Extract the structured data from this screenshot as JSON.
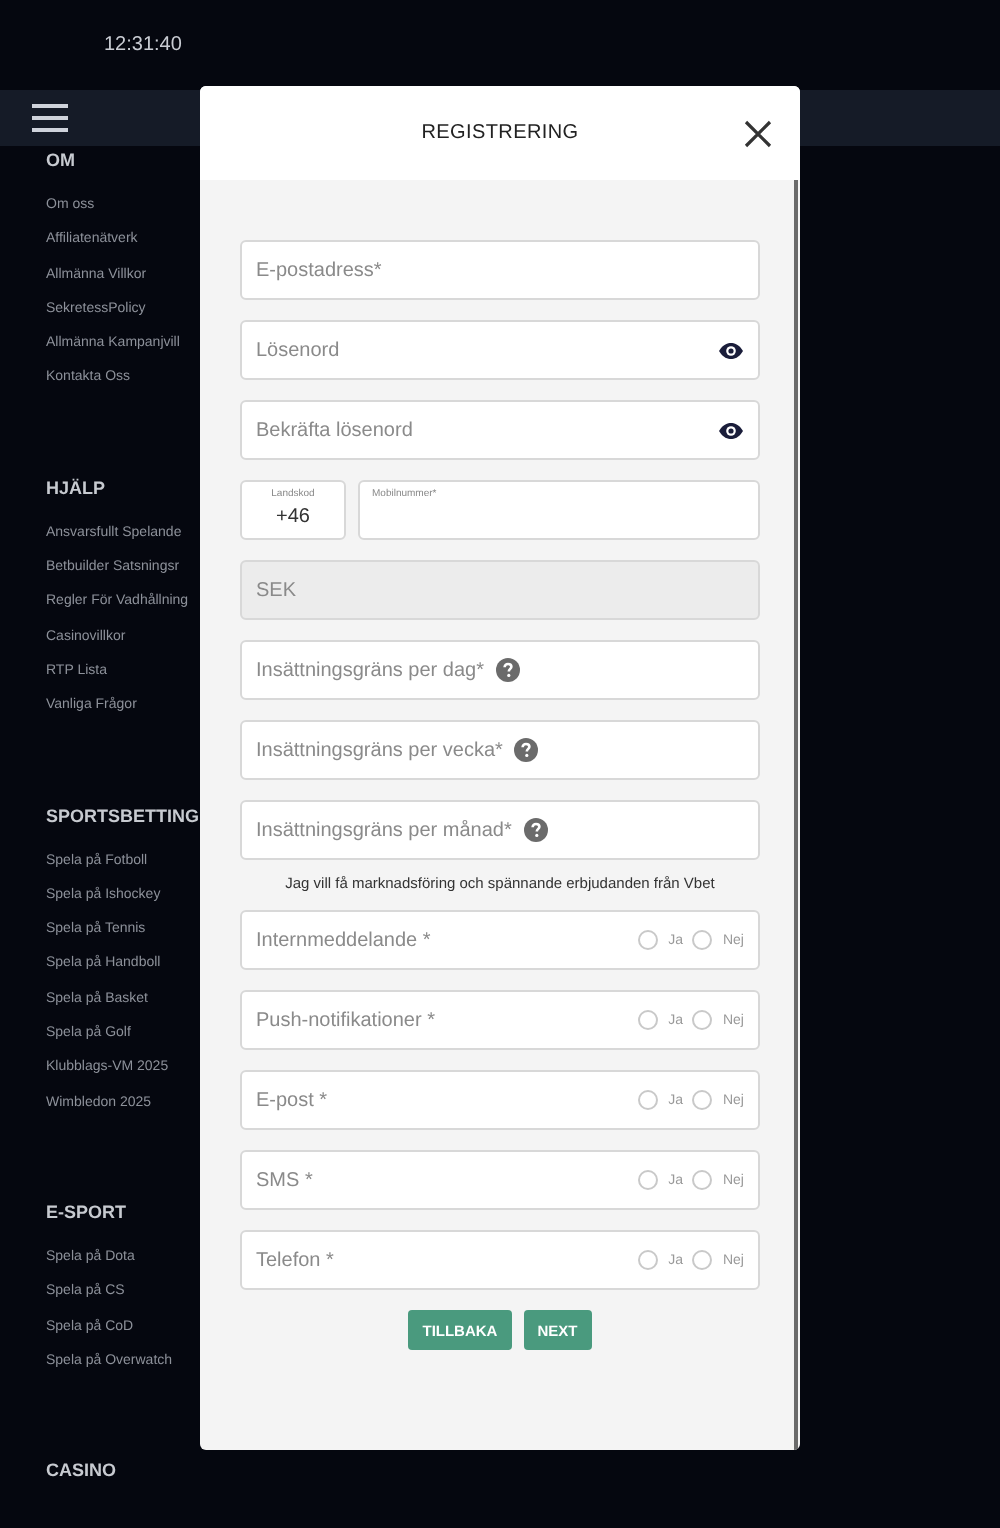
{
  "status_bar": {
    "time": "12:31:40"
  },
  "sidebar": [
    {
      "heading": "OM",
      "items": [
        "Om oss",
        "Affiliatenätverk",
        "Allmänna Villkor",
        "SekretessPolicy",
        "Allmänna Kampanjvill",
        "Kontakta Oss"
      ]
    },
    {
      "heading": "HJÄLP",
      "items": [
        "Ansvarsfullt Spelande",
        "Betbuilder Satsningsr",
        "Regler För Vadhållning",
        "Casinovillkor",
        "RTP Lista",
        "Vanliga Frågor"
      ]
    },
    {
      "heading": "SPORTSBETTING",
      "items": [
        "Spela på Fotboll",
        "Spela på Ishockey",
        "Spela på Tennis",
        "Spela på Handboll",
        "Spela på Basket",
        "Spela på Golf",
        "Klubblags-VM 2025",
        "Wimbledon 2025"
      ]
    },
    {
      "heading": "E-SPORT",
      "items": [
        "Spela på Dota",
        "Spela på CS",
        "Spela på CoD",
        "Spela på Overwatch"
      ]
    },
    {
      "heading": "CASINO"
    }
  ],
  "modal": {
    "title": "REGISTRERING",
    "fields": [
      {
        "kind": "text",
        "placeholder": "E-postadress*"
      },
      {
        "kind": "password",
        "placeholder": "Lösenord"
      },
      {
        "kind": "password",
        "placeholder": "Bekräfta lösenord"
      },
      {
        "kind": "phone",
        "code_label": "Landskod",
        "code_value": "+46",
        "number_label": "Mobilnummer*"
      },
      {
        "kind": "disabled",
        "value": "SEK"
      },
      {
        "kind": "help",
        "placeholder": "Insättningsgräns per dag*"
      },
      {
        "kind": "help",
        "placeholder": "Insättningsgräns per vecka*"
      },
      {
        "kind": "help",
        "placeholder": "Insättningsgräns per månad*"
      }
    ],
    "consent_text": "Jag vill få marknadsföring och spännande erbjudanden från Vbet",
    "consents": [
      {
        "label": "Internmeddelande *",
        "options": [
          {
            "label": "Ja",
            "selected": false
          },
          {
            "label": "Nej",
            "selected": false
          }
        ]
      },
      {
        "label": "Push-notifikationer *",
        "options": [
          {
            "label": "Ja",
            "selected": false
          },
          {
            "label": "Nej",
            "selected": false
          }
        ]
      },
      {
        "label": "E-post *",
        "options": [
          {
            "label": "Ja",
            "selected": false
          },
          {
            "label": "Nej",
            "selected": false
          }
        ]
      },
      {
        "label": "SMS *",
        "options": [
          {
            "label": "Ja",
            "selected": false
          },
          {
            "label": "Nej",
            "selected": false
          }
        ]
      },
      {
        "label": "Telefon *",
        "options": [
          {
            "label": "Ja",
            "selected": false
          },
          {
            "label": "Nej",
            "selected": false
          }
        ]
      }
    ],
    "buttons": [
      "TILLBAKA",
      "NEXT"
    ]
  }
}
